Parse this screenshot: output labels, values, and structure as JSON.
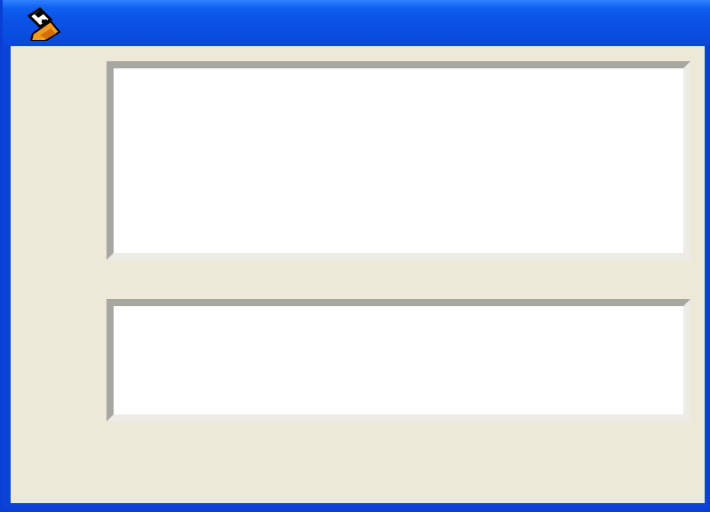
{
  "window": {
    "title": "",
    "icon": "pencil-eraser-icon"
  },
  "fields": {
    "top_text": "",
    "bottom_text": ""
  },
  "colors": {
    "titlebar": "#0a52e6",
    "client_background": "#ece9d8",
    "field_background": "#ffffff",
    "field_border_dark": "#a7a6a0"
  }
}
